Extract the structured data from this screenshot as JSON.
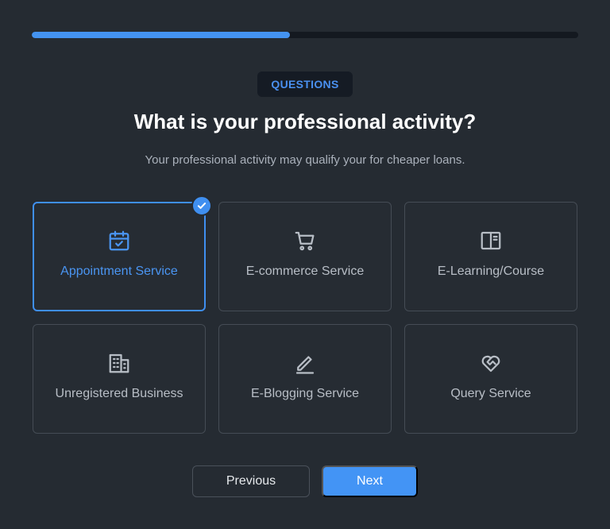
{
  "progress": {
    "value": 0.473
  },
  "badge": {
    "label": "QUESTIONS"
  },
  "heading": {
    "title": "What is your professional activity?",
    "subtitle": "Your professional activity may qualify your for cheaper loans."
  },
  "options": [
    {
      "label": "Appointment Service",
      "icon": "calendar-check-icon",
      "selected": true
    },
    {
      "label": "E-commerce Service",
      "icon": "shopping-cart-icon",
      "selected": false
    },
    {
      "label": "E-Learning/Course",
      "icon": "book-icon",
      "selected": false
    },
    {
      "label": "Unregistered Business",
      "icon": "building-icon",
      "selected": false
    },
    {
      "label": "E-Blogging Service",
      "icon": "pencil-icon",
      "selected": false
    },
    {
      "label": "Query Service",
      "icon": "heart-handshake-icon",
      "selected": false
    }
  ],
  "buttons": {
    "previous": "Previous",
    "next": "Next"
  },
  "colors": {
    "accent": "#4394f5",
    "background": "#252b32",
    "card_border": "#454c55"
  }
}
